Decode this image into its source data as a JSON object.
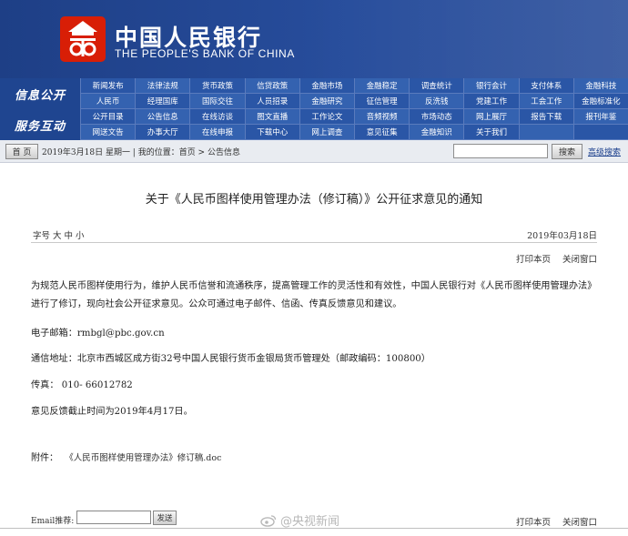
{
  "header": {
    "bank_name_cn": "中国人民银行",
    "bank_name_en": "THE PEOPLE'S BANK OF CHINA",
    "logo_icon": "pboc-logo-icon",
    "colors": {
      "header_bg": "#274d9c",
      "logo_red": "#d81e06"
    }
  },
  "nav": {
    "section1_label": "信息公开",
    "section2_label": "服务互动",
    "row1": [
      "新闻发布",
      "法律法规",
      "货币政策",
      "信贷政策",
      "金融市场",
      "金融稳定",
      "调查统计",
      "银行会计",
      "支付体系",
      "金融科技"
    ],
    "row2": [
      "人民币",
      "经理国库",
      "国际交往",
      "人员招录",
      "金融研究",
      "征信管理",
      "反洗钱",
      "党建工作",
      "工会工作",
      "金融标准化"
    ],
    "row3": [
      "公开目录",
      "公告信息",
      "在线访谈",
      "图文直播",
      "工作论文",
      "音频视频",
      "市场动态",
      "网上展厅",
      "报告下载",
      "报刊年鉴"
    ],
    "row4": [
      "网送文告",
      "办事大厅",
      "在线申报",
      "下载中心",
      "网上调查",
      "意见征集",
      "金融知识",
      "关于我们",
      "",
      ""
    ]
  },
  "searchbar": {
    "home_label": "首 页",
    "date_and_path": "2019年3月18日 星期一 | 我的位置：首页 > 公告信息",
    "search_placeholder": "",
    "search_button": "搜索",
    "advanced_search": "高级搜索"
  },
  "article": {
    "title": "关于《人民币图样使用管理办法（修订稿）》公开征求意见的通知",
    "font_size_label": "字号 大 中 小",
    "date": "2019年03月18日",
    "print_label": "打印本页",
    "close_label": "关闭窗口",
    "body": "为规范人民币图样使用行为，维护人民币信誉和流通秩序，提高管理工作的灵活性和有效性，中国人民银行对《人民币图样使用管理办法》进行了修订，现向社会公开征求意见。公众可通过电子邮件、信函、传真反馈意见和建议。",
    "email_line": "电子邮箱：rmbgl@pbc.gov.cn",
    "address_line": "通信地址：北京市西城区成方街32号中国人民银行货币金银局货币管理处（邮政编码：100800）",
    "fax_line": "传真：  010-  66012782",
    "deadline_line": "意见反馈截止时间为2019年4月17日。",
    "attachment_label": "附件：",
    "attachment_file": "《人民币图样使用管理办法》修订稿.doc"
  },
  "footer": {
    "email_recommend_label": "Email推荐:",
    "email_input_value": "",
    "send_button": "发送",
    "print_label": "打印本页",
    "close_label": "关闭窗口",
    "watermark": "@央视新闻",
    "watermark_icon": "weibo-icon"
  }
}
